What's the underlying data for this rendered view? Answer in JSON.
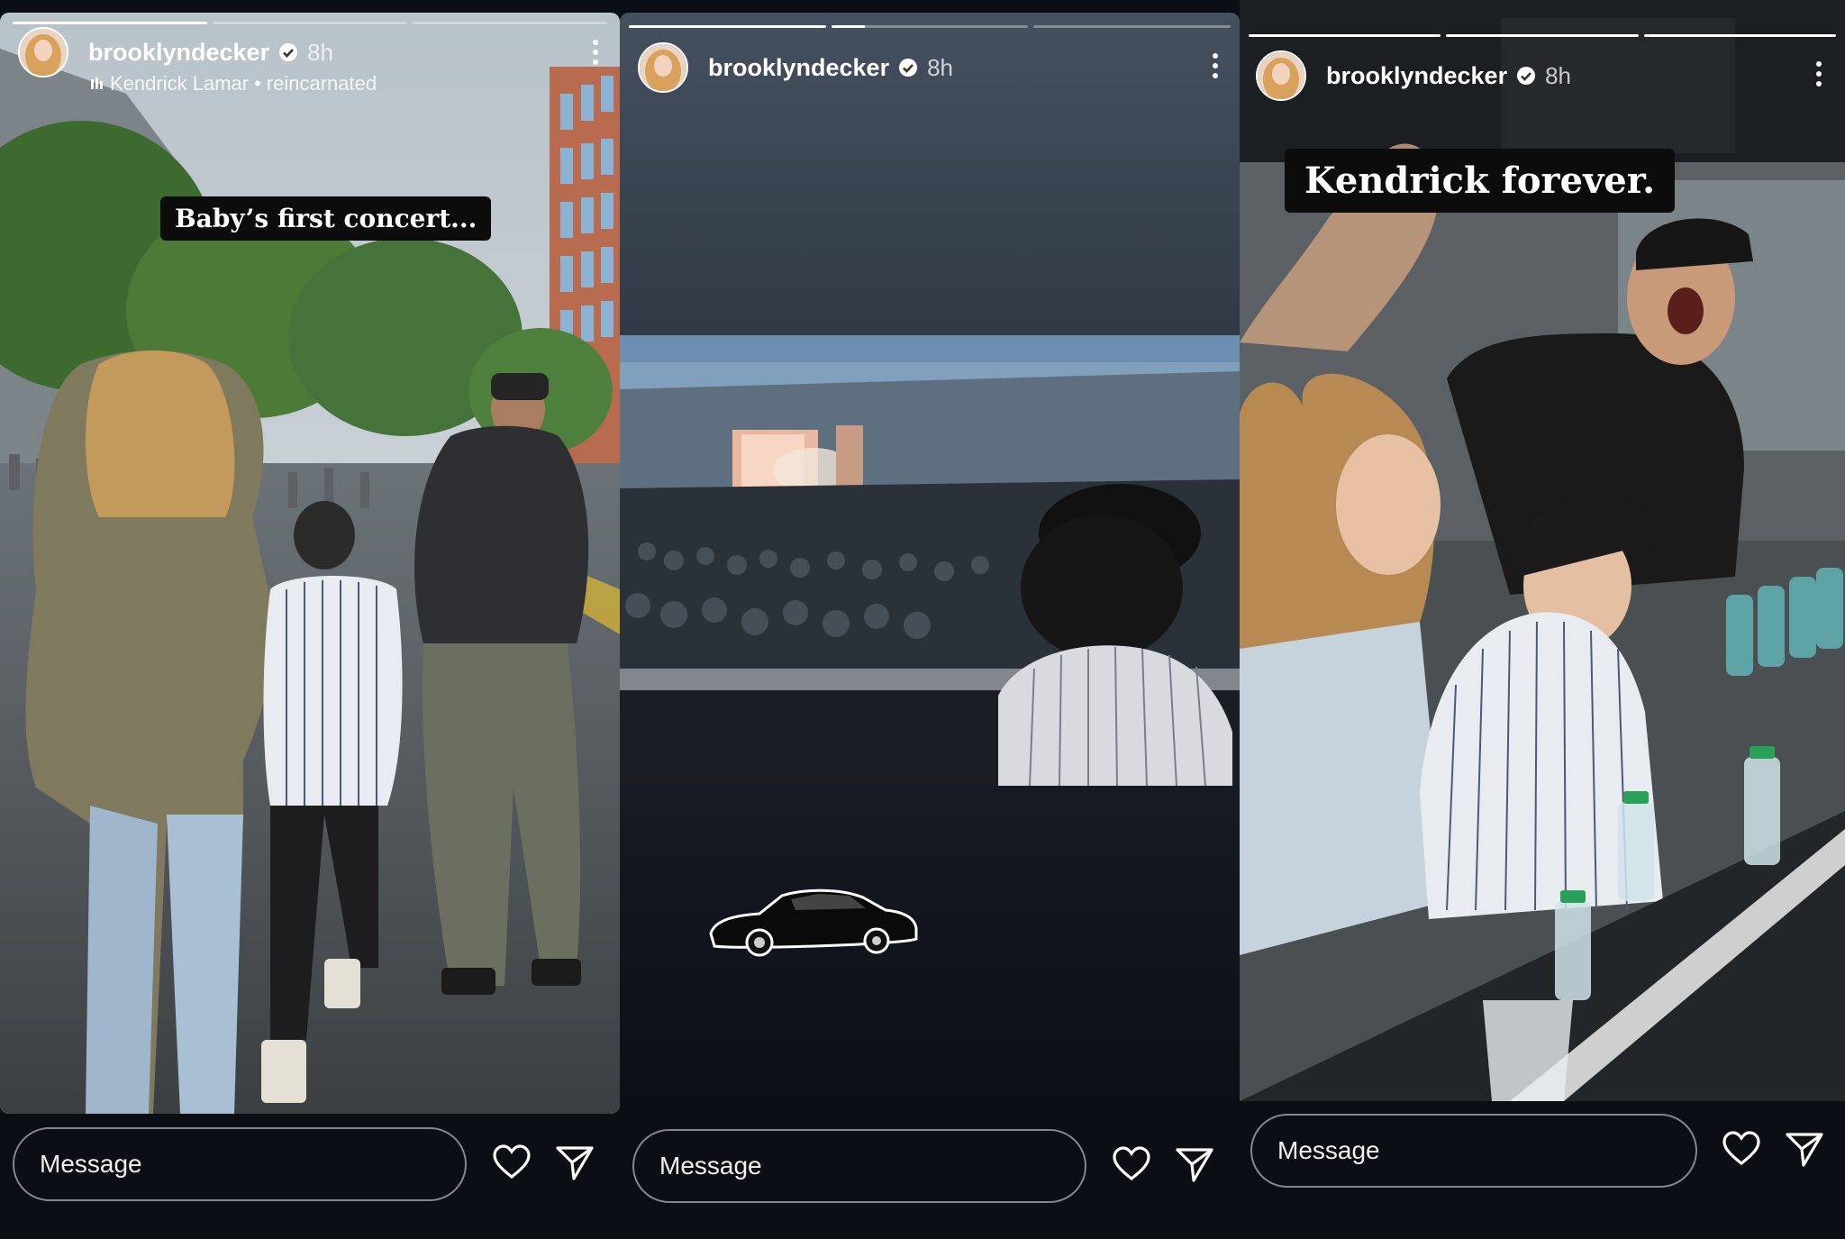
{
  "stories": [
    {
      "username": "brooklyndecker",
      "time": "8h",
      "music": {
        "artist": "Kendrick Lamar",
        "separator": "•",
        "track": "reincarnated"
      },
      "caption": "Baby’s first concert...",
      "progress": [
        1,
        0,
        0
      ],
      "message_placeholder": "Message"
    },
    {
      "username": "brooklyndecker",
      "time": "8h",
      "progress": [
        1,
        0.17,
        0
      ],
      "message_placeholder": "Message"
    },
    {
      "username": "brooklyndecker",
      "time": "8h",
      "caption": "Kendrick forever.",
      "progress": [
        1,
        1,
        1
      ],
      "message_placeholder": "Message"
    }
  ],
  "icons": {
    "verified": "verified-badge-icon",
    "more": "more-options-icon",
    "music": "music-bars-icon",
    "like": "heart-icon",
    "share": "send-icon",
    "sticker": "car-sticker-icon"
  },
  "colors": {
    "background": "#0b0e14",
    "caption_bg": "#0c0c0c",
    "story2_gradient_top": "#45505f",
    "story2_gradient_bottom": "#0c0e16"
  }
}
